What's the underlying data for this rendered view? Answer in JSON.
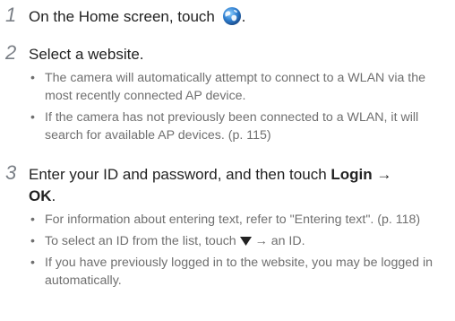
{
  "steps": [
    {
      "number": "1",
      "text": "On the Home screen, touch",
      "after_icon": ".",
      "icon": "globe-icon"
    },
    {
      "number": "2",
      "text": "Select a website.",
      "bullets": [
        "The camera will automatically attempt to connect to a WLAN via the most recently connected AP device.",
        "If the camera has not previously been connected to a WLAN, it will search for available AP devices. (p. 115)"
      ]
    },
    {
      "number": "3",
      "text_before": "Enter your ID and password, and then touch ",
      "bold1": "Login",
      "arrow": " → ",
      "bold2": "OK",
      "end": ".",
      "bullets": [
        "For information about entering text, refer to \"Entering text\". (p. 118)",
        "If you have previously logged in to the website, you may be logged in automatically."
      ],
      "bullet_id_select": {
        "before": "To select an ID from the list, touch ",
        "icon": "down-triangle-icon",
        "after": " → an ID."
      }
    }
  ],
  "bullet_char": "•",
  "colors": {
    "text": "#222222",
    "secondary_text": "#6f6f6f",
    "step_number": "#7a7f86",
    "icon_blue": "#2f7fd0"
  }
}
